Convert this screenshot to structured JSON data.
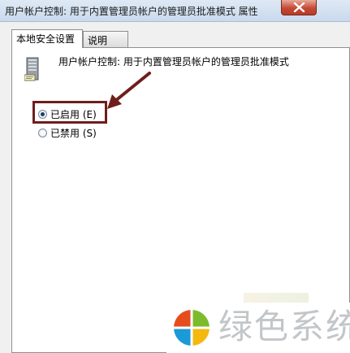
{
  "window": {
    "title": "用户帐户控制: 用于内置管理员帐户的管理员批准模式 属性"
  },
  "tabs": [
    {
      "label": "本地安全设置",
      "active": true
    },
    {
      "label": "说明",
      "active": false
    }
  ],
  "policy": {
    "title": "用户帐户控制: 用于内置管理员帐户的管理员批准模式",
    "icon": "computer-icon"
  },
  "options": [
    {
      "label": "已启用 (E)",
      "selected": true
    },
    {
      "label": "已禁用 (S)",
      "selected": false
    }
  ],
  "watermark": {
    "text": "绿色系统",
    "colors": [
      "#e74c1c",
      "#7cbb2c",
      "#1b9ad6",
      "#f5b80f"
    ]
  },
  "annotation": {
    "color": "#6e1f1c"
  }
}
